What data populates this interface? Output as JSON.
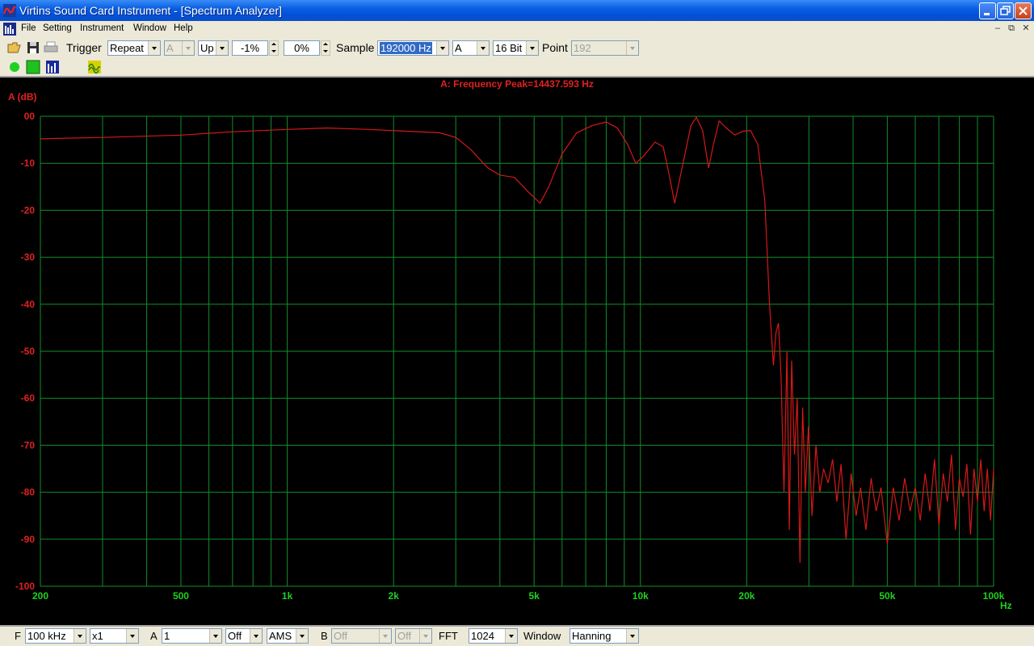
{
  "window": {
    "title": "Virtins Sound Card Instrument - [Spectrum Analyzer]"
  },
  "menu": {
    "items": [
      "File",
      "Setting",
      "Instrument",
      "Window",
      "Help"
    ]
  },
  "toolbar": {
    "trigger_label": "Trigger",
    "trigger_mode": "Repeat",
    "trigger_source": "A",
    "trigger_edge": "Up",
    "trigger_level": "-1%",
    "trigger_delay": "0%",
    "sample_label": "Sample",
    "sample_rate": "192000 Hz",
    "channel": "A",
    "bit_depth": "16 Bit",
    "point_label": "Point",
    "point_value": "192"
  },
  "statusbar": {
    "f_label": "F",
    "f_value": "100 kHz",
    "zoom": "x1",
    "a_label": "A",
    "a_value": "1",
    "a_mode": "Off",
    "a_ams": "AMS",
    "b_label": "B",
    "b_value": "Off",
    "b_mode": "Off",
    "fft_label": "FFT",
    "fft_value": "1024",
    "window_label": "Window",
    "window_value": "Hanning"
  },
  "colors": {
    "background": "#000000",
    "grid": "#0f8f2a",
    "trace": "#d61818",
    "y_text": "#e02020",
    "x_text": "#20d020"
  },
  "chart_data": {
    "type": "line",
    "title": "A: Frequency Peak=14437.593 Hz",
    "ylabel": "A (dB)",
    "xlabel": "Hz",
    "x_scale": "log",
    "xlim": [
      200,
      100000
    ],
    "ylim": [
      -100,
      0
    ],
    "grid": true,
    "y_ticks": [
      "00",
      "-10",
      "-20",
      "-30",
      "-40",
      "-50",
      "-60",
      "-70",
      "-80",
      "-90",
      "-100"
    ],
    "x_ticks": [
      {
        "value": 200,
        "label": "200"
      },
      {
        "value": 500,
        "label": "500"
      },
      {
        "value": 1000,
        "label": "1k"
      },
      {
        "value": 2000,
        "label": "2k"
      },
      {
        "value": 5000,
        "label": "5k"
      },
      {
        "value": 10000,
        "label": "10k"
      },
      {
        "value": 20000,
        "label": "20k"
      },
      {
        "value": 50000,
        "label": "50k"
      },
      {
        "value": 100000,
        "label": "100k"
      }
    ],
    "series": [
      {
        "x": [
          200,
          300,
          500,
          700,
          1000,
          1300,
          1700,
          2200,
          2700,
          3000,
          3300,
          3700,
          4000,
          4400,
          4800,
          5200,
          5500,
          6000,
          6600,
          7300,
          8000,
          8600,
          9200,
          9700,
          10200,
          11000,
          11600,
          12100,
          12500,
          13200,
          13900,
          14400,
          15000,
          15600,
          16100,
          16700,
          17500,
          18500,
          19500,
          20500,
          21500,
          22500,
          23200,
          23800,
          24200,
          24600,
          25000,
          25500,
          26000,
          26400,
          26800,
          27300,
          27800,
          28300,
          28800,
          29300,
          29900,
          30600,
          31400,
          32200,
          33000,
          34000,
          35000,
          36000,
          37000,
          38200,
          39500,
          40800,
          42000,
          43500,
          45000,
          46500,
          48000,
          50000,
          52000,
          54000,
          56000,
          58000,
          60000,
          62000,
          64000,
          66000,
          68000,
          70000,
          72000,
          74000,
          76000,
          78000,
          80000,
          82000,
          84000,
          86000,
          88000,
          90000,
          92000,
          94000,
          96000,
          98000,
          100000
        ],
        "y": [
          -4.8,
          -4.5,
          -4,
          -3.3,
          -2.8,
          -2.5,
          -2.8,
          -3.2,
          -3.5,
          -4.5,
          -7,
          -11,
          -12.5,
          -13,
          -16,
          -18.5,
          -15,
          -8,
          -3.5,
          -2,
          -1.2,
          -2.5,
          -6,
          -10,
          -8.5,
          -5.5,
          -6.5,
          -13,
          -18.5,
          -10,
          -2,
          -0.2,
          -3,
          -11,
          -6,
          -1,
          -2.5,
          -4,
          -3.2,
          -3,
          -6,
          -18,
          -40,
          -53,
          -46,
          -44,
          -55,
          -80,
          -50,
          -88,
          -52,
          -72,
          -60,
          -95,
          -62,
          -80,
          -66,
          -85,
          -70,
          -80,
          -75,
          -78,
          -73,
          -82,
          -74,
          -90,
          -76,
          -85,
          -79,
          -88,
          -77,
          -84,
          -79,
          -91,
          -79,
          -86,
          -77,
          -84,
          -79,
          -86,
          -76,
          -84,
          -73,
          -87,
          -76,
          -82,
          -72,
          -88,
          -77,
          -81,
          -74,
          -89,
          -75,
          -82,
          -73,
          -84,
          -75,
          -86,
          -75
        ]
      }
    ]
  }
}
